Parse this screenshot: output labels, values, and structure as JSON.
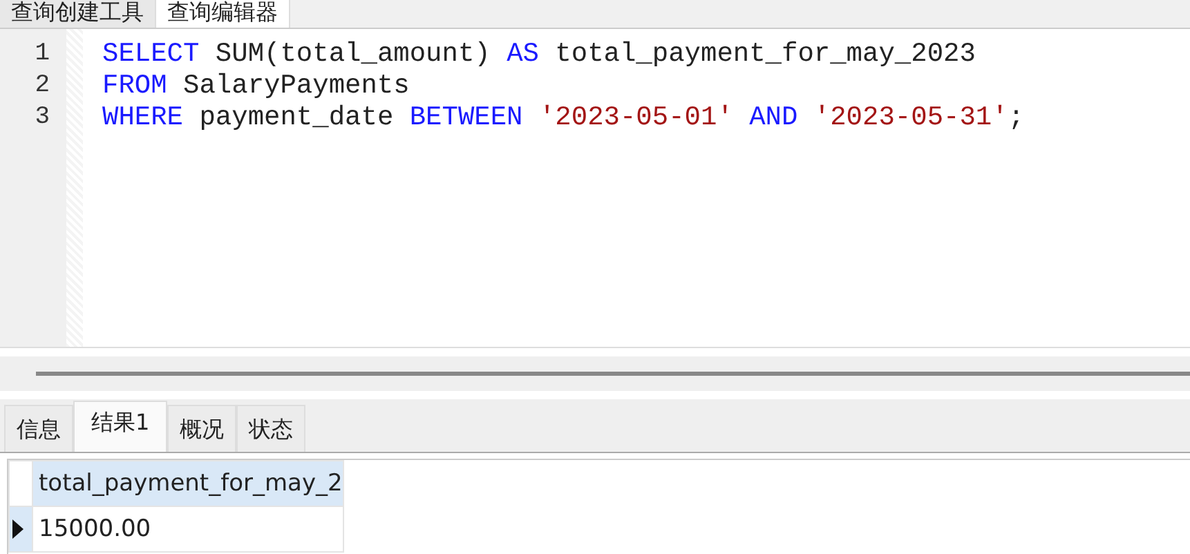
{
  "top_tabs": [
    {
      "label": "查询创建工具",
      "selected": false
    },
    {
      "label": "查询编辑器",
      "selected": true
    }
  ],
  "editor": {
    "lines": [
      {
        "number": "1",
        "tokens": [
          {
            "kind": "keyword",
            "text": "SELECT"
          },
          {
            "kind": "plain",
            "text": " SUM(total_amount) "
          },
          {
            "kind": "keyword",
            "text": "AS"
          },
          {
            "kind": "plain",
            "text": " total_payment_for_may_2023"
          }
        ]
      },
      {
        "number": "2",
        "tokens": [
          {
            "kind": "keyword",
            "text": "FROM"
          },
          {
            "kind": "plain",
            "text": " SalaryPayments"
          }
        ]
      },
      {
        "number": "3",
        "tokens": [
          {
            "kind": "keyword",
            "text": "WHERE"
          },
          {
            "kind": "plain",
            "text": " payment_date "
          },
          {
            "kind": "keyword",
            "text": "BETWEEN"
          },
          {
            "kind": "string",
            "text": " '2023-05-01'"
          },
          {
            "kind": "keyword",
            "text": " AND"
          },
          {
            "kind": "string",
            "text": " '2023-05-31'"
          },
          {
            "kind": "plain",
            "text": ";"
          }
        ]
      }
    ]
  },
  "result_tabs": [
    {
      "label": "信息",
      "selected": false
    },
    {
      "label": "结果1",
      "selected": true
    },
    {
      "label": "概况",
      "selected": false
    },
    {
      "label": "状态",
      "selected": false
    }
  ],
  "grid": {
    "columns": [
      "total_payment_for_may_2"
    ],
    "rows": [
      {
        "selected": true,
        "cells": [
          "15000.00"
        ]
      }
    ]
  }
}
